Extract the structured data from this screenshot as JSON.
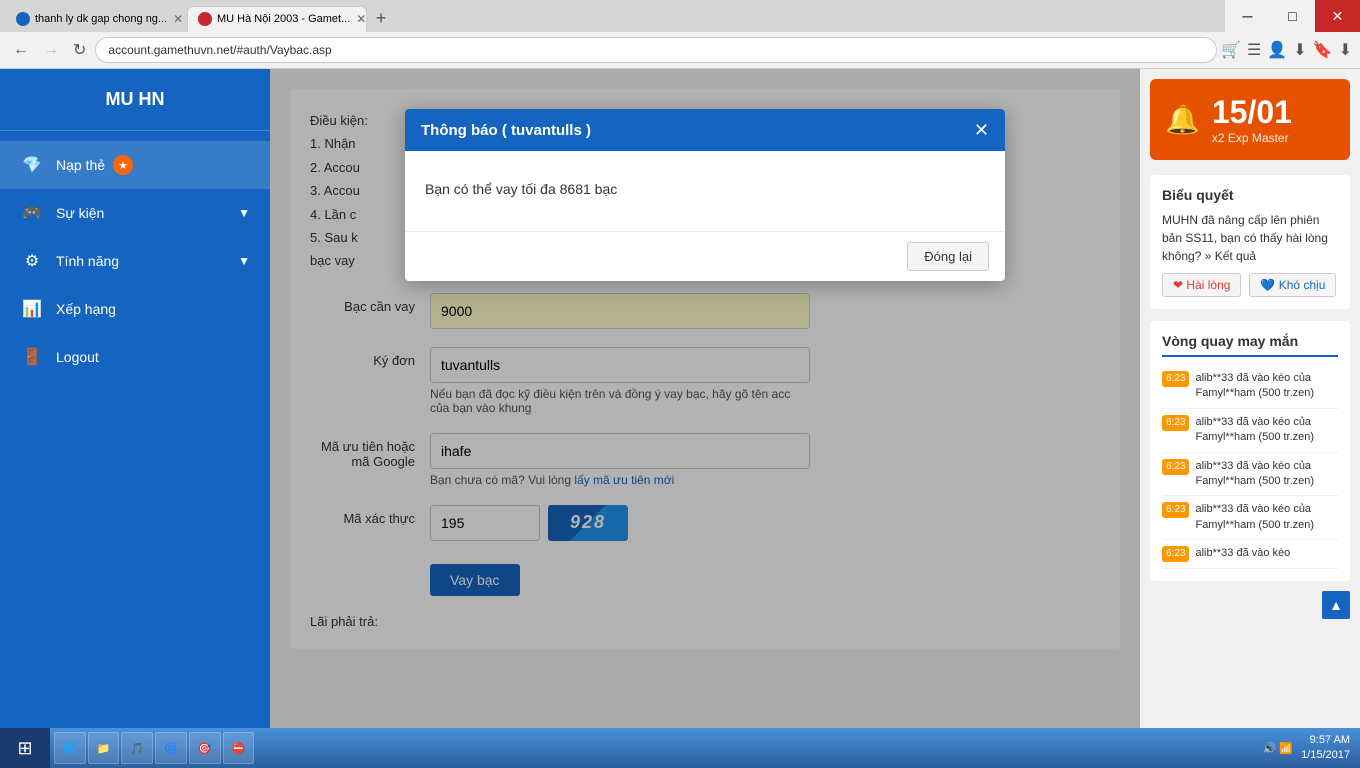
{
  "browser": {
    "tabs": [
      {
        "id": "tab1",
        "label": "thanh ly dk gap chong ng...",
        "active": false,
        "favicon": "blue"
      },
      {
        "id": "tab2",
        "label": "MU Hà Nội 2003 - Gamet...",
        "active": true,
        "favicon": "red"
      }
    ],
    "address": "account.gamethuvn.net/#auth/Vaybac.asp",
    "add_tab_label": "+"
  },
  "sidebar": {
    "items": [
      {
        "id": "nap-the",
        "label": "Nạp thẻ",
        "icon": "💎",
        "badge": "★",
        "has_arrow": false
      },
      {
        "id": "su-kien",
        "label": "Sự kiện",
        "icon": "🎮",
        "has_arrow": true
      },
      {
        "id": "tinh-nang",
        "label": "Tính năng",
        "icon": "⚙",
        "has_arrow": true
      },
      {
        "id": "xep-hang",
        "label": "Xếp hạng",
        "icon": "📊",
        "has_arrow": false
      },
      {
        "id": "logout",
        "label": "Logout",
        "icon": "🚪",
        "has_arrow": false
      }
    ]
  },
  "form": {
    "conditions_title": "Điều kiện:",
    "condition1": "1. Nhận",
    "condition2": "2. Accou",
    "condition3": "3. Accou",
    "condition4": "4. Lần c",
    "condition5": "5. Sau k",
    "condition5b": "bạc vay",
    "bac_can_vay_label": "Bạc cần vay",
    "bac_can_vay_value": "9000",
    "ky_don_label": "Ký đơn",
    "ky_don_value": "tuvantulls",
    "ky_don_hint": "Nếu bạn đã đọc kỹ điều kiện trên và đồng ý vay bạc, hãy gõ tên acc của bạn vào khung",
    "ma_uu_tien_label": "Mã ưu tiên hoặc mã Google",
    "ma_uu_tien_value": "ihafe",
    "ma_hint_prefix": "Bạn chưa có mã? Vui lòng",
    "ma_hint_link": "lấy mã ưu tiên mới",
    "ma_xac_thuc_label": "Mã xác thực",
    "ma_xac_thuc_value": "195",
    "captcha_text": "928",
    "submit_label": "Vay bạc",
    "lai_label": "Lãi phải trả:"
  },
  "modal": {
    "title": "Thông báo ( tuvantulls )",
    "message": "Bạn có thể vay tối đa 8681 bạc",
    "close_btn": "Đóng lại"
  },
  "right_panel": {
    "promo": {
      "icon": "🔔",
      "date": "15/01",
      "label": "x2 Exp Master"
    },
    "poll": {
      "title": "Biểu quyết",
      "text": "MUHN đã nâng cấp lên phiên bản SS11, bạn có thấy hài lòng không? » Kết quả",
      "love_btn": "❤ Hài lòng",
      "sad_btn": "💙 Khó chịu"
    },
    "lucky": {
      "title": "Vòng quay may mắn",
      "items": [
        {
          "time": "6:23",
          "text": "alib**33 đã vào kéo của Famyl**ham (500 tr.zen)"
        },
        {
          "time": "6:23",
          "text": "alib**33 đã vào kéo của Famyl**ham (500 tr.zen)"
        },
        {
          "time": "6:23",
          "text": "alib**33 đã vào kéo của Famyl**ham (500 tr.zen)"
        },
        {
          "time": "6:23",
          "text": "alib**33 đã vào kéo của Famyl**ham (500 tr.zen)"
        },
        {
          "time": "6:23",
          "text": "alib**33 đã vào kéo"
        }
      ]
    }
  },
  "taskbar": {
    "items": [
      {
        "id": "t1",
        "label": "⊞"
      },
      {
        "id": "t2",
        "label": "🌐"
      },
      {
        "id": "t3",
        "label": "📁"
      },
      {
        "id": "t4",
        "label": "🎵"
      },
      {
        "id": "t5",
        "label": "🌀"
      },
      {
        "id": "t6",
        "label": "🎯"
      },
      {
        "id": "t7",
        "label": "⛔"
      }
    ],
    "time": "9:57 AM",
    "date": "1/15/2017"
  },
  "scroll_to_top": "▲"
}
